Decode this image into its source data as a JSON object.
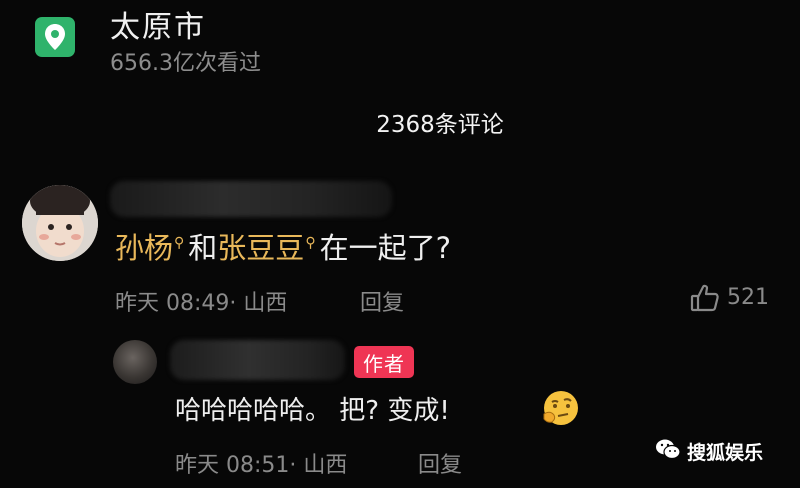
{
  "location": {
    "name": "太原市",
    "views": "656.3亿次看过",
    "icon": "location-pin-icon",
    "icon_color": "#2fb36b"
  },
  "comments_header": {
    "count_label": "2368条评论"
  },
  "comment": {
    "mention_1": "孙杨",
    "connector": "和",
    "mention_2": "张豆豆",
    "rest": "在一起了?",
    "time": "昨天 08:49",
    "region": "· 山西",
    "reply_label": "回复",
    "like_count": "521",
    "mention_color": "#e9b85a"
  },
  "reply": {
    "author_tag": "作者",
    "text": "哈哈哈哈哈。 把? 变成!",
    "emoji": "thinking-face-icon",
    "time": "昨天 08:51",
    "region": "· 山西",
    "reply_label": "回复",
    "tag_color": "#ef3554"
  },
  "watermark": {
    "text": "搜狐娱乐"
  }
}
